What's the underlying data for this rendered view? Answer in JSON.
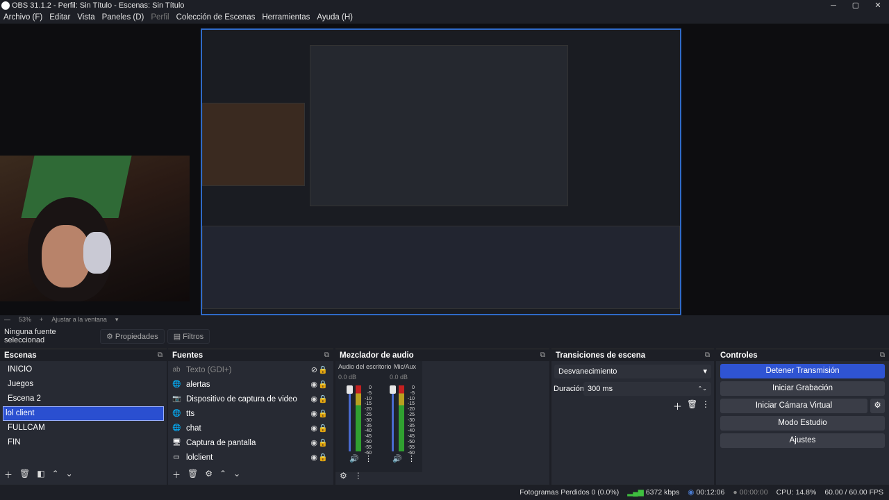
{
  "window": {
    "title": "OBS 31.1.2 - Perfil: Sin Título - Escenas: Sin Título",
    "min": "─",
    "max": "▢",
    "close": "✕"
  },
  "menu": [
    "Archivo (F)",
    "Editar",
    "Vista",
    "Paneles (D)",
    "Perfil",
    "Colección de Escenas",
    "Herramientas",
    "Ayuda (H)"
  ],
  "zoom": {
    "minus": "—",
    "value": "53%",
    "plus": "+",
    "fit": "Ajustar a la ventana"
  },
  "props": {
    "no_source": "Ninguna fuente seleccionad",
    "properties": "Propiedades",
    "filters": "Filtros"
  },
  "scenes": {
    "title": "Escenas",
    "items": [
      "INICIO",
      "Juegos",
      "Escena 2",
      "lol client",
      "FULLCAM",
      "FIN"
    ],
    "selected": "lol client"
  },
  "sources": {
    "title": "Fuentes",
    "items": [
      {
        "name": "Texto (GDI+)",
        "icon": "ab",
        "hidden": true
      },
      {
        "name": "alertas",
        "icon": "🌐"
      },
      {
        "name": "Dispositivo de captura de video",
        "icon": "📷"
      },
      {
        "name": "tts",
        "icon": "🌐"
      },
      {
        "name": "chat",
        "icon": "🌐"
      },
      {
        "name": "Captura de pantalla",
        "icon": "🖥"
      },
      {
        "name": "lolclient",
        "icon": "▭"
      }
    ]
  },
  "mixer": {
    "title": "Mezclador de audio",
    "channels": [
      {
        "name": "Audio del escritorio",
        "db": "0.0 dB"
      },
      {
        "name": "Mic/Aux",
        "db": "0.0 dB"
      }
    ],
    "scale": [
      "0",
      "-5",
      "-10",
      "-15",
      "-20",
      "-25",
      "-30",
      "-35",
      "-40",
      "-45",
      "-50",
      "-55",
      "-60"
    ]
  },
  "transitions": {
    "title": "Transiciones de escena",
    "selected": "Desvanecimiento",
    "duration_label": "Duración",
    "duration_value": "300 ms"
  },
  "controls": {
    "title": "Controles",
    "stop_stream": "Detener Transmisión",
    "start_rec": "Iniciar Grabación",
    "start_vcam": "Iniciar Cámara Virtual",
    "studio": "Modo Estudio",
    "settings": "Ajustes"
  },
  "status": {
    "dropped": "Fotogramas Perdidos 0 (0.0%)",
    "bitrate": "6372 kbps",
    "stream_time": "00:12:06",
    "rec_time": "00:00:00",
    "cpu": "CPU: 14.8%",
    "fps": "60.00 / 60.00 FPS"
  },
  "colors": {
    "accent": "#2f54d3",
    "selection": "#2a4fd0",
    "bg": "#1d1f26",
    "panel": "#272a33"
  }
}
